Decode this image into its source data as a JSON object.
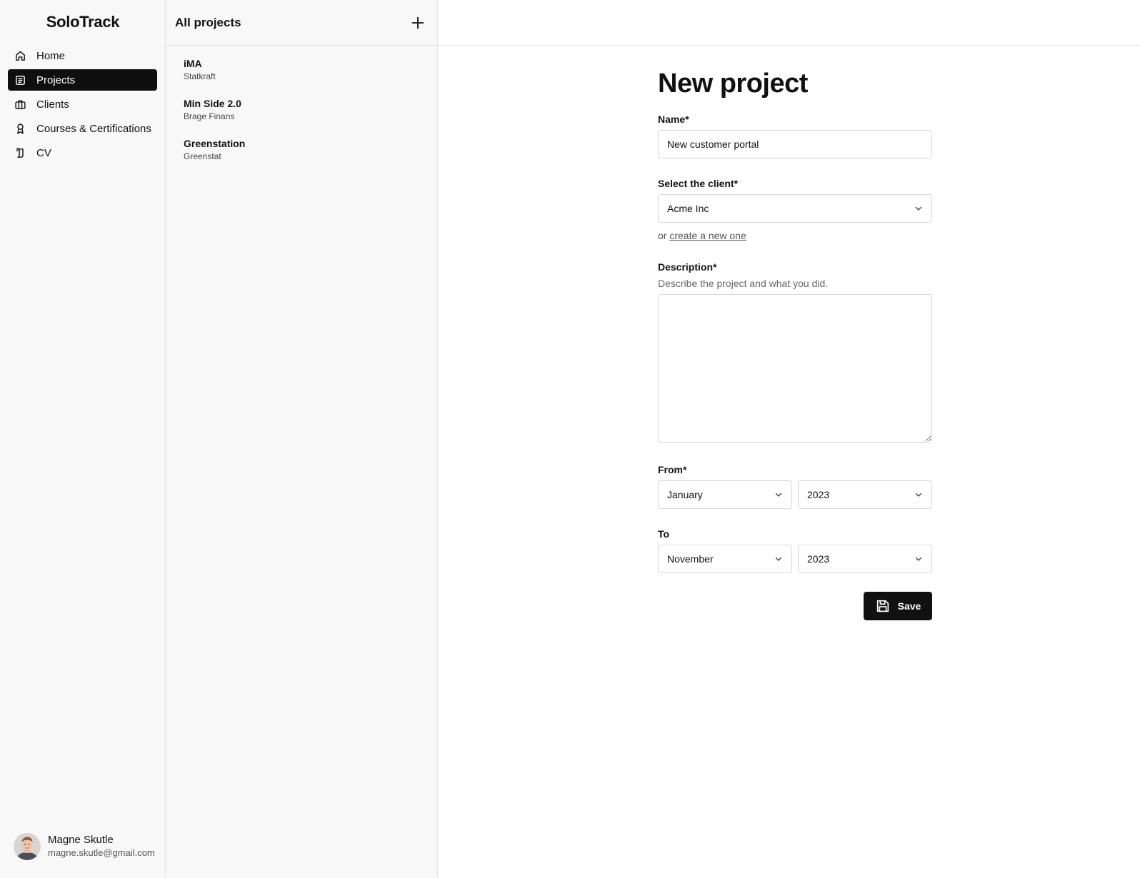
{
  "app": {
    "logo": "SoloTrack"
  },
  "sidebar": {
    "items": [
      {
        "label": "Home",
        "icon": "home-icon"
      },
      {
        "label": "Projects",
        "icon": "projects-icon",
        "active": true
      },
      {
        "label": "Clients",
        "icon": "briefcase-icon"
      },
      {
        "label": "Courses & Certifications",
        "icon": "award-icon"
      },
      {
        "label": "CV",
        "icon": "scroll-icon"
      }
    ],
    "user": {
      "name": "Magne Skutle",
      "email": "magne.skutle@gmail.com"
    }
  },
  "project_list": {
    "title": "All projects",
    "projects": [
      {
        "name": "iMA",
        "client": "Statkraft"
      },
      {
        "name": "Min Side 2.0",
        "client": "Brage Finans"
      },
      {
        "name": "Greenstation",
        "client": "Greenstat"
      }
    ]
  },
  "form": {
    "title": "New project",
    "name": {
      "label": "Name*",
      "value": "New customer portal"
    },
    "client": {
      "label": "Select the client*",
      "value": "Acme Inc",
      "helper_prefix": "or ",
      "helper_link": "create a new one"
    },
    "description": {
      "label": "Description*",
      "hint": "Describe the project and what you did.",
      "value": ""
    },
    "from": {
      "label": "From*",
      "month": "January",
      "year": "2023"
    },
    "to": {
      "label": "To",
      "month": "November",
      "year": "2023"
    },
    "save_label": "Save"
  },
  "colors": {
    "accent": "#0f0f0f",
    "sidebar_bg": "#f8f8f8",
    "border": "#e3e3e3"
  }
}
